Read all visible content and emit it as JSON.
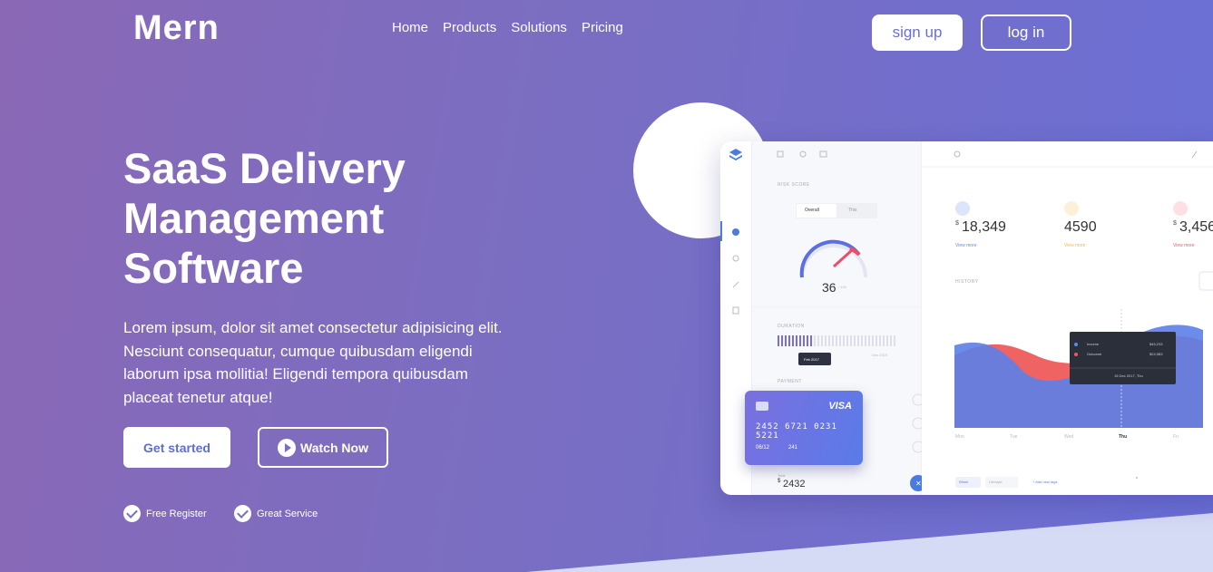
{
  "brand": {
    "logo": "Mern"
  },
  "nav": {
    "items": [
      "Home",
      "Products",
      "Solutions",
      "Pricing"
    ]
  },
  "auth": {
    "signup": "sign up",
    "login": "log in"
  },
  "hero": {
    "title_lines": [
      "SaaS Delivery",
      "Management",
      "Software"
    ],
    "description": "Lorem ipsum, dolor sit amet consectetur adipisicing elit. Nesciunt consequatur, cumque quibusdam eligendi laborum ipsa mollitia! Eligendi tempora quibusdam placeat tenetur atque!",
    "cta_primary": "Get started",
    "cta_secondary": "Watch Now",
    "features": [
      "Free Register",
      "Great Service"
    ]
  },
  "dashboard": {
    "risk_label": "RISK SCORE",
    "toggle": [
      "Overall",
      "This"
    ],
    "gauge_value": "36",
    "gauge_max": "/ 100",
    "duration_label": "DURATION",
    "duration_tooltip": "Feb 2017",
    "duration_end": "Dec 2019",
    "payment_label": "PAYMENT",
    "stats": [
      {
        "currency": "$",
        "value": "18,349",
        "link": "View more",
        "color": "#5b8def"
      },
      {
        "currency": "",
        "value": "4590",
        "link": "View more",
        "color": "#f5b74a"
      },
      {
        "currency": "$",
        "value": "3,456",
        "link": "View more",
        "color": "#ef5b6b"
      }
    ],
    "history_label": "HISTORY",
    "legend": [
      {
        "name": "Income",
        "value": "$45,233",
        "color": "#5b8def"
      },
      {
        "name": "Outcome",
        "value": "$24,983",
        "color": "#ef5b5b"
      }
    ],
    "legend_date": "15 Dec 2017, Thu",
    "x_labels": [
      "Mon",
      "Tue",
      "Wed",
      "Thu",
      "Fri"
    ],
    "filters": [
      "Week",
      "Lifestyle",
      "+ Add new tags"
    ],
    "card": {
      "brand": "VISA",
      "number": "2452 6721 0231 5221",
      "expiry": "06/12",
      "cvv": "241"
    },
    "total_label": "Total",
    "total_value": "2432"
  }
}
